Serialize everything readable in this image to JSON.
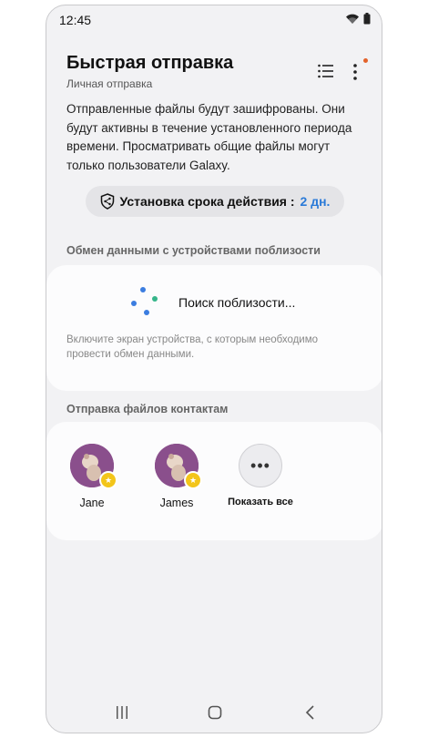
{
  "status_bar": {
    "time": "12:45"
  },
  "header": {
    "title": "Быстрая отправка",
    "subtitle": "Личная отправка"
  },
  "description": "Отправленные файлы будут зашифрованы. Они будут активны в течение установленного периода времени. Просматривать общие файлы могут только пользователи Galaxy.",
  "expiry": {
    "label": "Установка срока действия :",
    "value": "2 дн."
  },
  "nearby": {
    "section_title": "Обмен данными с устройствами поблизости",
    "search_text": "Поиск поблизости...",
    "hint": "Включите экран устройства, с которым необходимо провести обмен данными."
  },
  "contacts": {
    "section_title": "Отправка файлов контактам",
    "items": [
      {
        "name": "Jane"
      },
      {
        "name": "James"
      }
    ],
    "show_all_label": "Показать все"
  },
  "colors": {
    "accent": "#2a7ad8",
    "notification_dot": "#e3622a",
    "avatar_bg": "#8a4f8c",
    "badge_yellow": "#f3c51a"
  },
  "icons": {
    "wifi": "wifi-icon",
    "battery": "battery-icon",
    "list": "list-icon",
    "more": "more-vertical-icon",
    "shield": "shield-share-icon",
    "recents": "recents-icon",
    "home": "home-icon",
    "back": "back-icon"
  }
}
